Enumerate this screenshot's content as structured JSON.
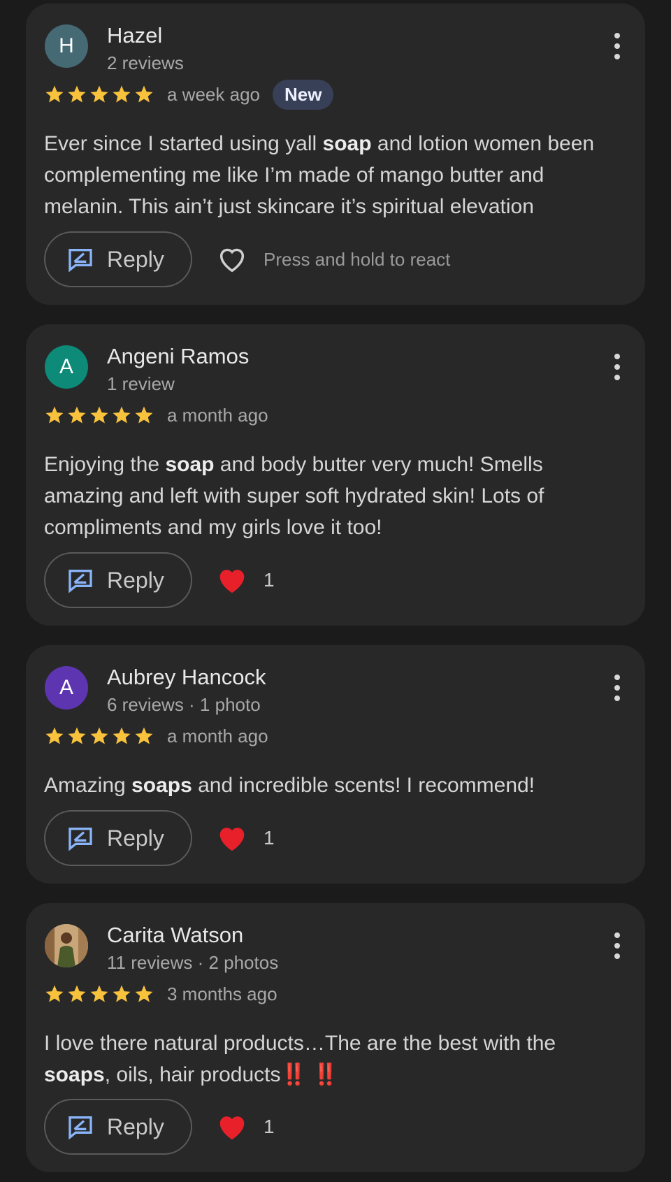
{
  "reviews": [
    {
      "avatar_letter": "H",
      "avatar_color": "#456a74",
      "name": "Hazel",
      "meta": "2 reviews",
      "rating": 5,
      "time": "a week ago",
      "badge": "New",
      "text_before": "Ever since I started using yall ",
      "text_bold": "soap",
      "text_after": " and lotion women been complementing me like I’m made of mango butter and melanin. This ain’t just skincare it’s spiritual elevation",
      "reply_label": "Reply",
      "react_hint": "Press and hold to react"
    },
    {
      "avatar_letter": "A",
      "avatar_color": "#0d8a78",
      "name": "Angeni Ramos",
      "meta": "1 review",
      "rating": 5,
      "time": "a month ago",
      "text_before": "Enjoying the ",
      "text_bold": "soap",
      "text_after": " and body butter very much! Smells amazing and left with super soft hydrated skin! Lots of compliments and my girls love it too!",
      "reply_label": "Reply",
      "reaction_count": "1"
    },
    {
      "avatar_letter": "A",
      "avatar_color": "#5e35b1",
      "name": "Aubrey Hancock",
      "meta": "6 reviews · 1 photo",
      "rating": 5,
      "time": "a month ago",
      "text_before": "Amazing ",
      "text_bold": "soaps",
      "text_after": " and incredible scents! I recommend!",
      "reply_label": "Reply",
      "reaction_count": "1"
    },
    {
      "avatar_icon": "profile-photo",
      "name": "Carita Watson",
      "meta": "11 reviews · 2 photos",
      "rating": 5,
      "time": "3 months ago",
      "text_before": "I love there natural products…The are the best with the ",
      "text_bold": "soaps",
      "text_after": ", oils, hair products",
      "text_emoji": "‼️ ‼️",
      "reply_label": "Reply",
      "reaction_count": "1"
    }
  ],
  "colors": {
    "star": "#f9c23c",
    "reply_icon": "#8ab4f8",
    "heart": "#e8202a"
  }
}
